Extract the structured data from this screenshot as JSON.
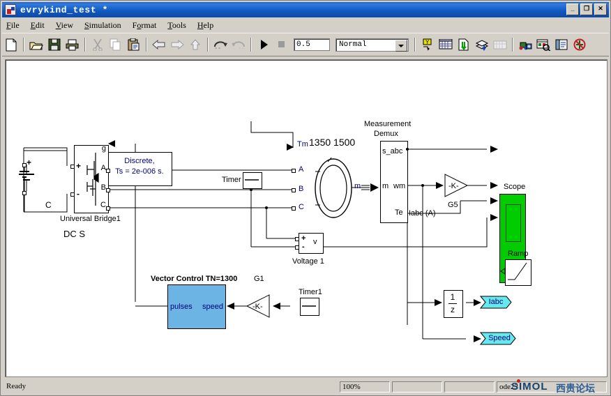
{
  "window": {
    "title": "evrykind_test *",
    "app_icon": "simulink-model-icon",
    "buttons": {
      "minimize": "_",
      "maximize": "❐",
      "close": "✕"
    }
  },
  "menu": {
    "items": [
      {
        "label": "File",
        "accel": "F"
      },
      {
        "label": "Edit",
        "accel": "E"
      },
      {
        "label": "View",
        "accel": "V"
      },
      {
        "label": "Simulation",
        "accel": "S"
      },
      {
        "label": "Format",
        "accel": "o"
      },
      {
        "label": "Tools",
        "accel": "T"
      },
      {
        "label": "Help",
        "accel": "H"
      }
    ]
  },
  "toolbar": {
    "icons": [
      "new-model-icon",
      "open-folder-icon",
      "save-disk-icon",
      "print-icon",
      "cut-scissors-icon",
      "copy-icon",
      "paste-clipboard-icon",
      "back-arrow-icon",
      "forward-arrow-icon",
      "up-arrow-icon",
      "undo-icon",
      "redo-icon",
      "start-simulation-icon",
      "stop-simulation-icon"
    ],
    "stop_time_value": "0.5",
    "simulation_mode": "Normal",
    "right_icons": [
      "library-browser-icon",
      "model-explorer-icon",
      "update-diagram-icon",
      "model-layers-icon",
      "debug-icon",
      "build-model-icon",
      "model-inspector-icon",
      "toggle-panel-icon",
      "disable-links-icon"
    ]
  },
  "statusbar": {
    "message": "Ready",
    "zoom": "100%",
    "cell_b": "",
    "cell_c": "",
    "solver": "ode23",
    "watermark": {
      "brand": "SIMOL",
      "cn": "西贵论坛"
    }
  },
  "diagram": {
    "annotations": {
      "discrete": "Discrete,\nTs = 2e-006 s.",
      "discrete_line1": "Discrete,",
      "discrete_line2": "Ts = 2e-006 s.",
      "speed_refs": "1350  1500",
      "vector_control_title": "Vector Control TN=1300",
      "iabc_signal": "Iabc (A)"
    },
    "blocks": {
      "dc_source": {
        "name": "DC S",
        "port_c": "C"
      },
      "universal_bridge": {
        "name": "Universal Bridge1",
        "ports": [
          "g",
          "A",
          "B",
          "C"
        ],
        "port_plus": "+",
        "port_minus": "-"
      },
      "timer": {
        "name": "Timer"
      },
      "timer1": {
        "name": "Timer1"
      },
      "machine": {
        "port_tm": "Tm",
        "port_a": "A",
        "port_b": "B",
        "port_c": "C",
        "port_m": "m"
      },
      "measurement_demux": {
        "name_line1": "Measurement",
        "name_line2": "Demux",
        "ports": [
          "s_abc",
          "m",
          "wm",
          "Te"
        ]
      },
      "gain_g5": {
        "name": "G5",
        "value": "-K-"
      },
      "gain_g1": {
        "name": "G1",
        "value": "-K-"
      },
      "scope": {
        "name": "Scope",
        "color": "#00cc00",
        "inputs": 4
      },
      "ramp": {
        "name": "Ramp"
      },
      "voltage": {
        "name": "Voltage 1",
        "port_plus": "+",
        "port_minus": "-",
        "port_v": "v"
      },
      "vector_control": {
        "port_in": "pulses",
        "port_out": "speed",
        "color": "#6cb4e4"
      },
      "unit_delay": {
        "numerator": "1",
        "denominator": "z"
      },
      "goto_iabc": {
        "label": "Iabc",
        "color": "#66e8ee"
      },
      "goto_speed": {
        "label": "Speed",
        "color": "#66e8ee"
      }
    }
  }
}
